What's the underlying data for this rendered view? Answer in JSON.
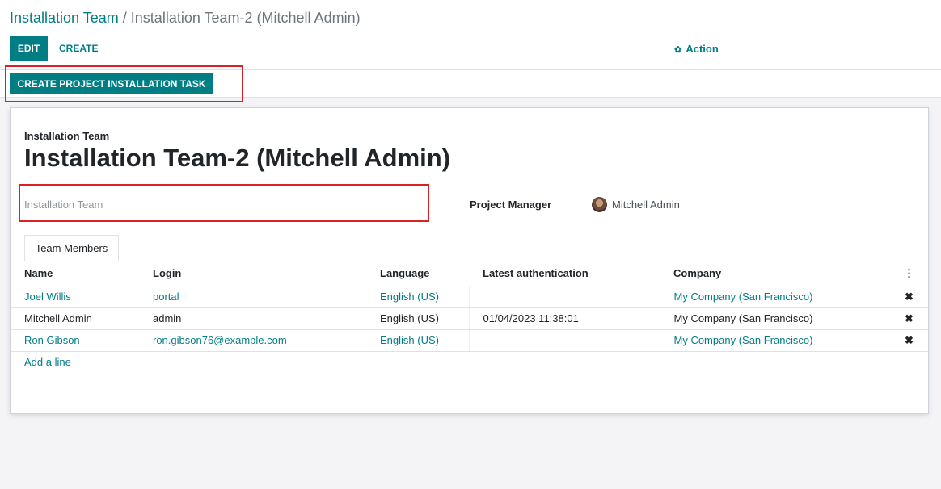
{
  "breadcrumb": {
    "parent": "Installation Team",
    "separator": "/",
    "current": "Installation Team-2 (Mitchell Admin)"
  },
  "toolbar": {
    "edit_label": "EDIT",
    "create_label": "CREATE",
    "action_label": "Action",
    "action_icon": "gear-icon"
  },
  "statusbar": {
    "task_button_label": "CREATE PROJECT INSTALLATION TASK"
  },
  "form": {
    "record_type_label": "Installation Team",
    "title": "Installation Team-2 (Mitchell Admin)",
    "team_field_placeholder": "Installation Team",
    "project_manager_label": "Project Manager",
    "project_manager_value": "Mitchell Admin"
  },
  "tabs": [
    {
      "label": "Team Members"
    }
  ],
  "table": {
    "columns": [
      "Name",
      "Login",
      "Language",
      "Latest authentication",
      "Company"
    ],
    "options_icon": "⋮",
    "delete_icon": "✖",
    "rows": [
      {
        "name": "Joel Willis",
        "login": "portal",
        "language": "English (US)",
        "auth": "",
        "company": "My Company (San Francisco)"
      },
      {
        "name": "Mitchell Admin",
        "login": "admin",
        "language": "English (US)",
        "auth": "01/04/2023 11:38:01",
        "company": "My Company (San Francisco)"
      },
      {
        "name": "Ron Gibson",
        "login": "ron.gibson76@example.com",
        "language": "English (US)",
        "auth": "",
        "company": "My Company (San Francisco)"
      }
    ],
    "add_line_label": "Add a line"
  },
  "colors": {
    "accent": "#017e84",
    "highlight_border": "#d92128"
  }
}
